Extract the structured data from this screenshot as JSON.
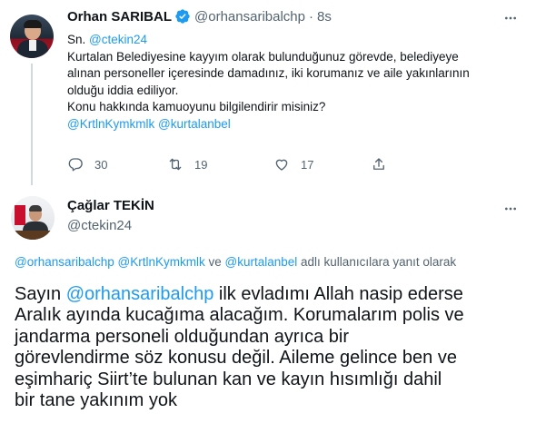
{
  "tweet": {
    "name": "Orhan SARIBAL",
    "handle": "@orhansaribalchp",
    "separator": "·",
    "time": "8s",
    "lines": [
      {
        "prefix": "Sn. ",
        "mention": "@ctekin24"
      },
      {
        "text": "Kurtalan Belediyesine kayyım olarak bulunduğunuz görevde, belediyeye"
      },
      {
        "text": "alınan personeller içeresinde damadınız, iki korumanız ve aile yakınlarının"
      },
      {
        "text": "olduğu iddia ediliyor."
      },
      {
        "text": "Konu hakkında kamuoyunu bilgilendirir misiniz?"
      }
    ],
    "mentions_line": {
      "m1": "@KrtlnKymkmlk",
      "m2": "@kurtalanbel"
    },
    "actions": {
      "reply_count": "30",
      "retweet_count": "19",
      "like_count": "17"
    }
  },
  "reply": {
    "name": "Çağlar TEKİN",
    "handle": "@ctekin24",
    "replying_to": {
      "m1": "@orhansaribalchp",
      "m2": "@KrtlnKymkmlk",
      "joiner": " ve ",
      "m3": "@kurtalanbel",
      "suffix": " adlı kullanıcılara yanıt olarak"
    },
    "lines": [
      {
        "prefix": "Sayın ",
        "mention": "@orhansaribalchp",
        "suffix": " ilk evladımı Allah nasip ederse"
      },
      {
        "text": "Aralık ayında kucağıma alacağım. Korumalarım polis ve"
      },
      {
        "text": "jandarma personeli olduğundan ayrıca bir"
      },
      {
        "text": "görevlendirme söz konusu değil. Aileme gelince ben ve"
      },
      {
        "text": "eşimhariç Siirt’te bulunan kan ve kayın hısımlığı dahil"
      },
      {
        "text": "bir tane yakınım yok"
      }
    ]
  },
  "colors": {
    "link": "#1d9bf0",
    "secondary_text": "#536471",
    "primary_text": "#0f1419",
    "thread_line": "#cfd9de"
  },
  "icons": {
    "verified": "verified-badge-icon",
    "more": "more-dots-icon",
    "reply": "reply-bubble-icon",
    "retweet": "retweet-icon",
    "like": "heart-icon",
    "share": "share-upload-icon"
  }
}
